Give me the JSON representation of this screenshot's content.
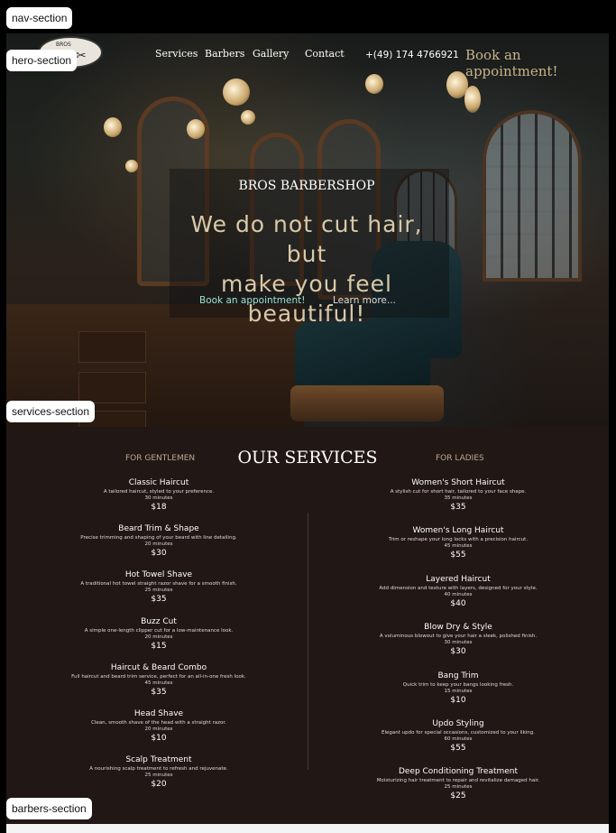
{
  "labels": {
    "nav": "nav-section",
    "hero": "hero-section",
    "services": "services-section",
    "barbers": "barbers-section"
  },
  "nav": {
    "links": [
      "Services",
      "Barbers",
      "Gallery",
      "Contact"
    ],
    "phone": "+(49) 174 4766921",
    "book": "Book an appointment!"
  },
  "hero": {
    "brand": "BROS BARBERSHOP",
    "headline_1": "We do not cut hair, but",
    "headline_2": "make you feel beautiful!",
    "book": "Book an appointment!",
    "learn": "Learn more..."
  },
  "services": {
    "title": "OUR SERVICES",
    "gentlemen_heading": "FOR GENTLEMEN",
    "ladies_heading": "FOR LADIES",
    "gentlemen": [
      {
        "name": "Classic Haircut",
        "desc": "A tailored haircut, styled to your preference.",
        "time": "30 minutes",
        "price": "$18"
      },
      {
        "name": "Beard Trim & Shape",
        "desc": "Precise trimming and shaping of your beard with line detailing.",
        "time": "20 minutes",
        "price": "$30"
      },
      {
        "name": "Hot Towel Shave",
        "desc": "A traditional hot towel straight razor shave for a smooth finish.",
        "time": "25 minutes",
        "price": "$35"
      },
      {
        "name": "Buzz Cut",
        "desc": "A simple one-length clipper cut for a low-maintenance look.",
        "time": "20 minutes",
        "price": "$15"
      },
      {
        "name": "Haircut & Beard Combo",
        "desc": "Full haircut and beard trim service, perfect for an all-in-one fresh look.",
        "time": "45 minutes",
        "price": "$35"
      },
      {
        "name": "Head Shave",
        "desc": "Clean, smooth shave of the head with a straight razor.",
        "time": "20 minutes",
        "price": "$10"
      },
      {
        "name": "Scalp Treatment",
        "desc": "A nourishing scalp treatment to refresh and rejuvenate.",
        "time": "25 minutes",
        "price": "$20"
      }
    ],
    "ladies": [
      {
        "name": "Women's Short Haircut",
        "desc": "A stylish cut for short hair, tailored to your face shape.",
        "time": "35 minutes",
        "price": "$35"
      },
      {
        "name": "Women's Long Haircut",
        "desc": "Trim or reshape your long locks with a precision haircut.",
        "time": "45 minutes",
        "price": "$55"
      },
      {
        "name": "Layered Haircut",
        "desc": "Add dimension and texture with layers, designed for your style.",
        "time": "40 minutes",
        "price": "$40"
      },
      {
        "name": "Blow Dry & Style",
        "desc": "A voluminous blowout to give your hair a sleek, polished finish.",
        "time": "30 minutes",
        "price": "$30"
      },
      {
        "name": "Bang Trim",
        "desc": "Quick trim to keep your bangs looking fresh.",
        "time": "15 minutes",
        "price": "$10"
      },
      {
        "name": "Updo Styling",
        "desc": "Elegant updo for special occasions, customized to your liking.",
        "time": "60 minutes",
        "price": "$55"
      },
      {
        "name": "Deep Conditioning Treatment",
        "desc": "Moisturizing hair treatment to repair and revitalize damaged hair.",
        "time": "25 minutes",
        "price": "$25"
      }
    ]
  }
}
